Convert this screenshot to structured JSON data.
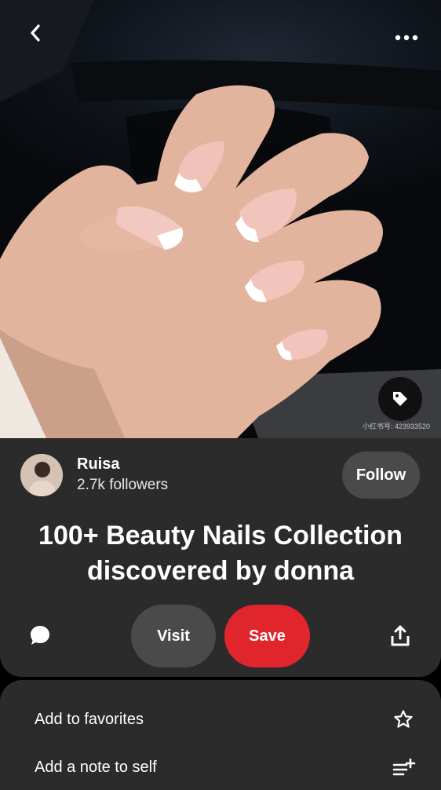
{
  "header": {
    "back_icon": "chevron-left-icon",
    "more_icon": "more-horizontal-icon"
  },
  "image": {
    "tag_icon": "tag-icon",
    "watermark": "小红书号: 423933520"
  },
  "creator": {
    "name": "Ruisa",
    "followers": "2.7k followers",
    "follow_label": "Follow"
  },
  "pin": {
    "title": "100+ Beauty Nails Collection discovered by donna"
  },
  "actions": {
    "comment_icon": "comment-icon",
    "visit_label": "Visit",
    "save_label": "Save",
    "share_icon": "share-icon",
    "save_color": "#e0252d"
  },
  "sheet": {
    "items": [
      {
        "label": "Add to favorites",
        "icon": "star-icon"
      },
      {
        "label": "Add a note to self",
        "icon": "note-add-icon"
      }
    ]
  }
}
